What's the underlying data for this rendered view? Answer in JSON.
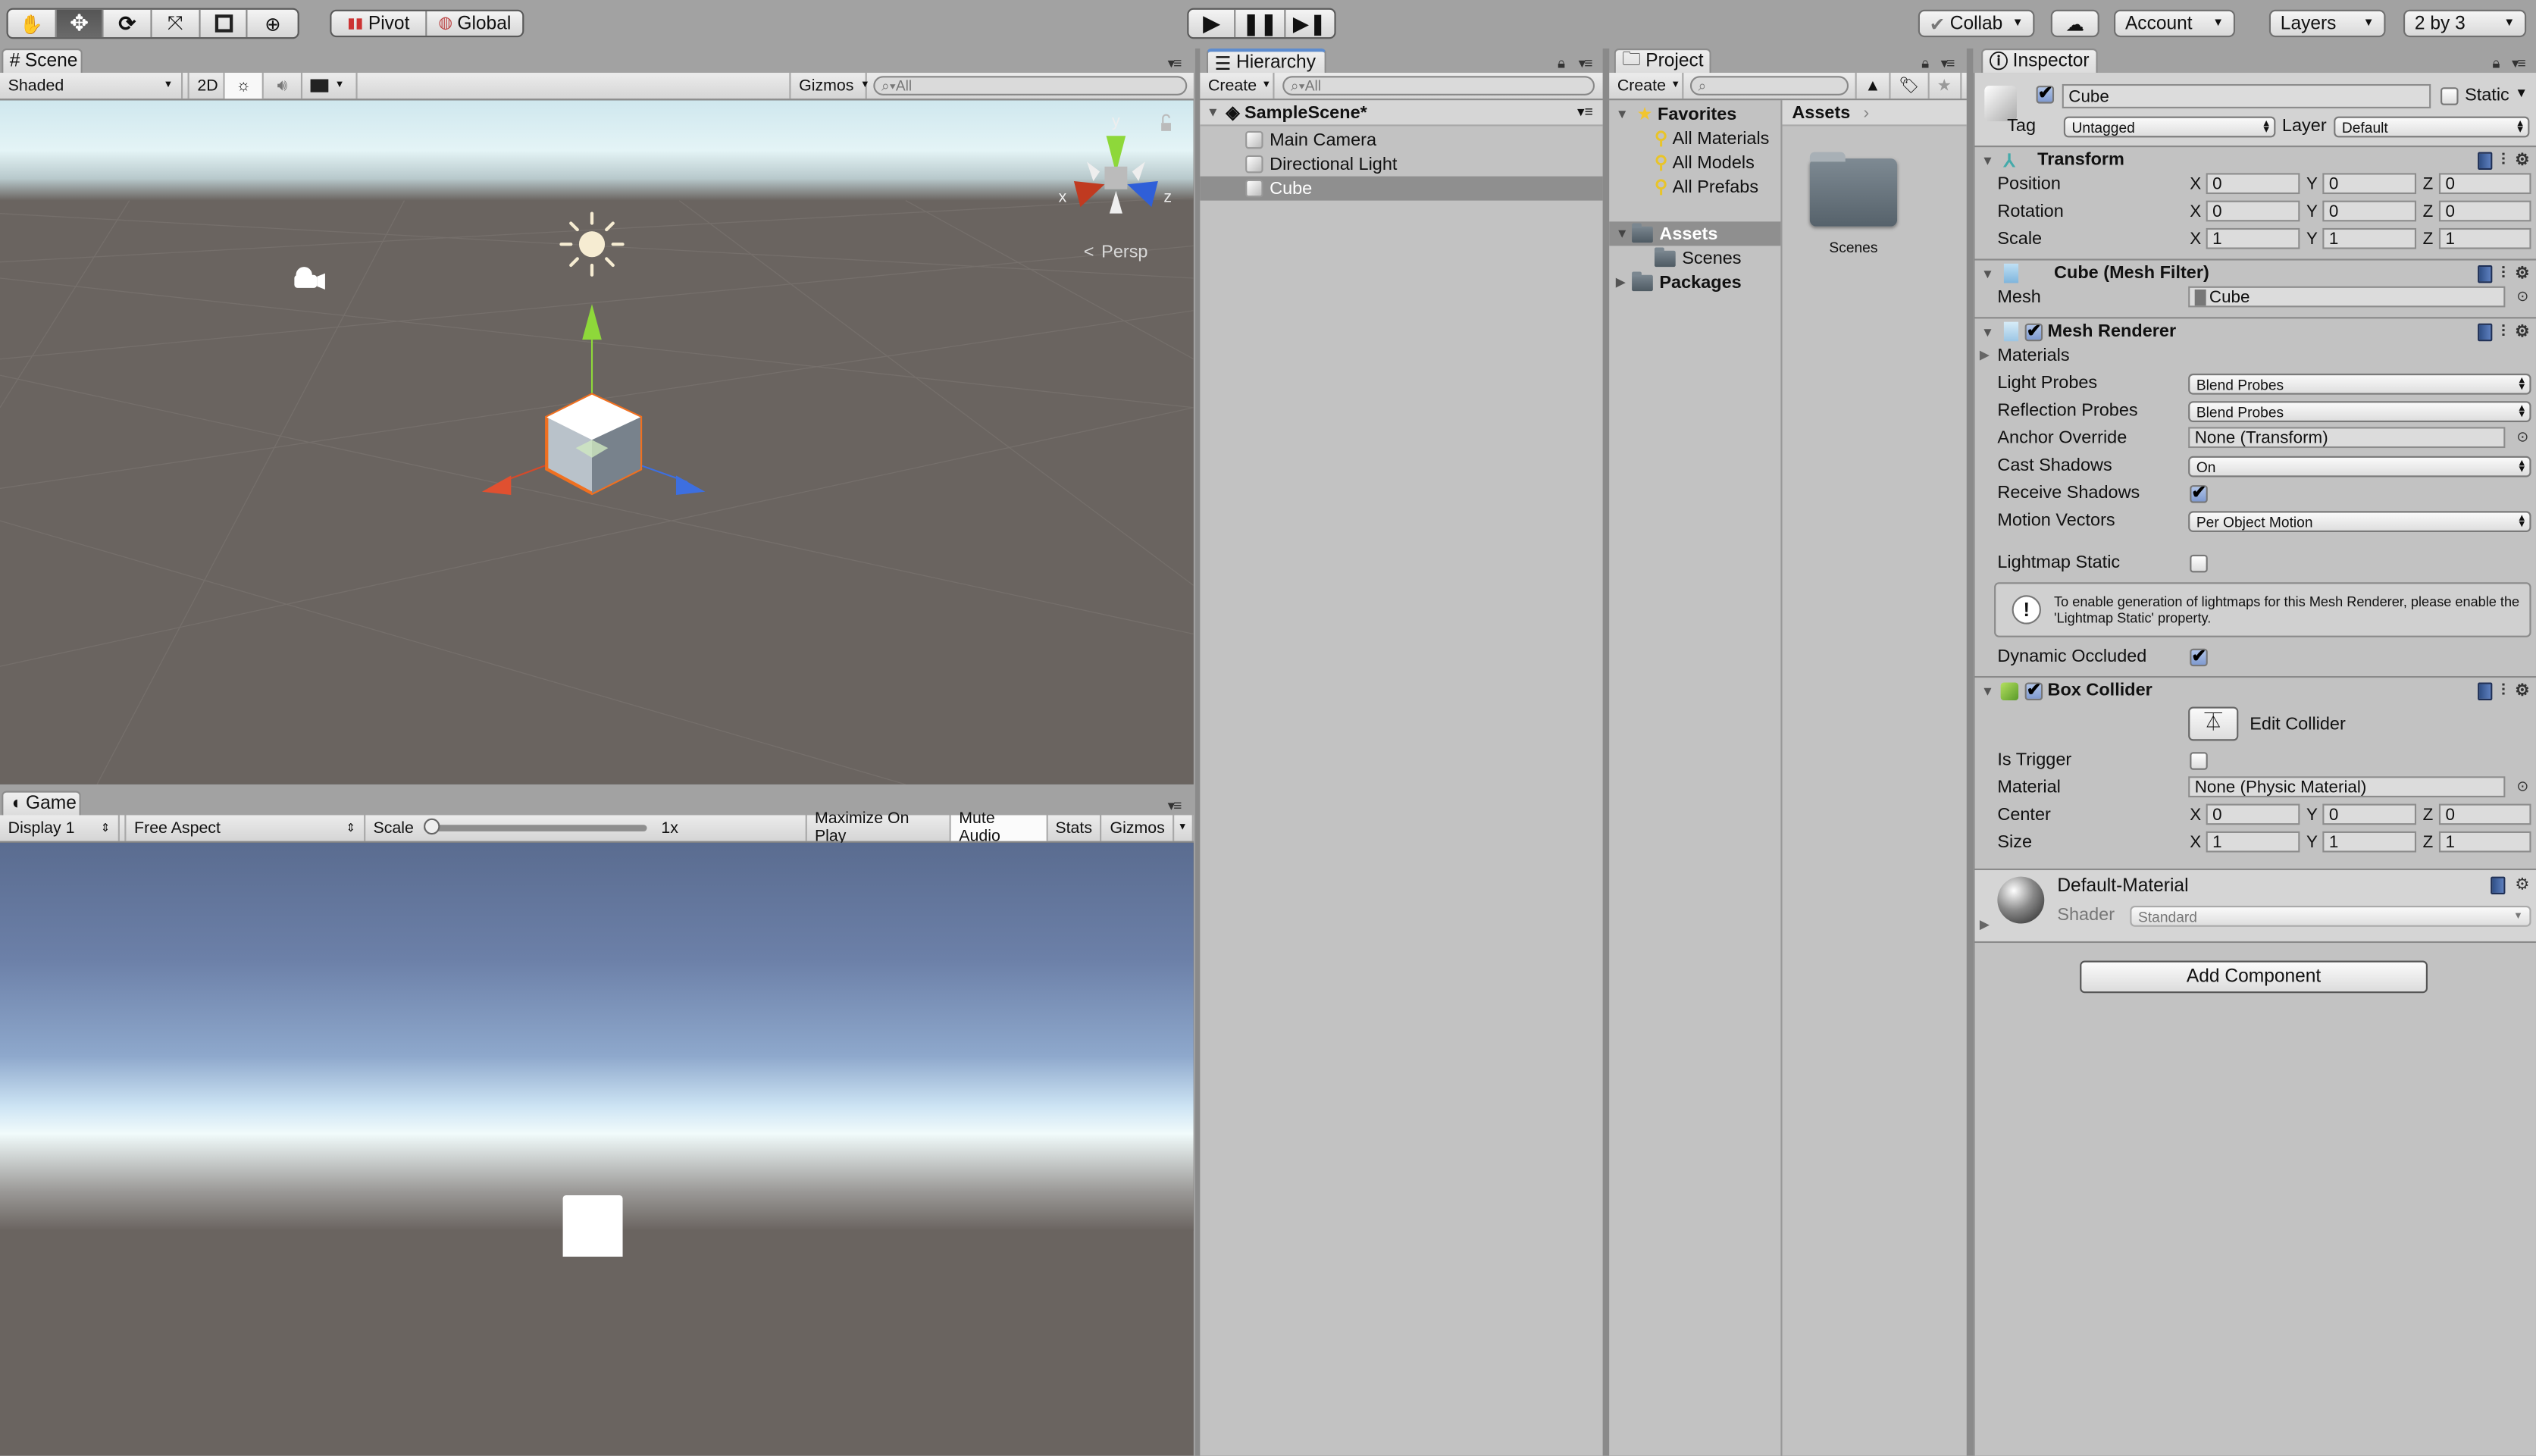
{
  "toolbar": {
    "tools": [
      "hand-tool",
      "move-tool",
      "rotate-tool",
      "scale-tool",
      "rect-tool",
      "transform-tool"
    ],
    "active_tool": "move-tool",
    "pivot_label": "Pivot",
    "global_label": "Global",
    "collab_label": "Collab",
    "account_label": "Account",
    "layers_label": "Layers",
    "layout_label": "2 by 3"
  },
  "scene": {
    "tab_label": "Scene",
    "shading_mode": "Shaded",
    "mode_2d_label": "2D",
    "gizmos_label": "Gizmos",
    "search_placeholder": "All",
    "axis_labels": {
      "x": "x",
      "y": "y",
      "z": "z"
    },
    "projection_label": "Persp"
  },
  "game": {
    "tab_label": "Game",
    "display_label": "Display 1",
    "aspect_label": "Free Aspect",
    "scale_label": "Scale",
    "scale_value": "1x",
    "scale_fraction": 0,
    "maximize_label": "Maximize On Play",
    "mute_label": "Mute Audio",
    "stats_label": "Stats",
    "gizmos_label": "Gizmos"
  },
  "hierarchy": {
    "tab_label": "Hierarchy",
    "create_label": "Create",
    "search_placeholder": "All",
    "scene_name": "SampleScene*",
    "items": [
      {
        "label": "Main Camera",
        "selected": false
      },
      {
        "label": "Directional Light",
        "selected": false
      },
      {
        "label": "Cube",
        "selected": true
      }
    ]
  },
  "project": {
    "tab_label": "Project",
    "create_label": "Create",
    "search_placeholder": "",
    "favorites_label": "Favorites",
    "favorites": [
      "All Materials",
      "All Models",
      "All Prefabs"
    ],
    "assets_label": "Assets",
    "assets_children": [
      "Scenes"
    ],
    "packages_label": "Packages",
    "breadcrumb": "Assets",
    "grid_items": [
      {
        "label": "Scenes",
        "type": "folder"
      }
    ]
  },
  "inspector": {
    "tab_label": "Inspector",
    "object_name": "Cube",
    "object_active": true,
    "static_label": "Static",
    "static_checked": false,
    "tag_label": "Tag",
    "tag_value": "Untagged",
    "layer_label": "Layer",
    "layer_value": "Default",
    "transform": {
      "title": "Transform",
      "rows": [
        {
          "label": "Position",
          "x": "0",
          "y": "0",
          "z": "0"
        },
        {
          "label": "Rotation",
          "x": "0",
          "y": "0",
          "z": "0"
        },
        {
          "label": "Scale",
          "x": "1",
          "y": "1",
          "z": "1"
        }
      ]
    },
    "mesh_filter": {
      "title": "Cube (Mesh Filter)",
      "mesh_label": "Mesh",
      "mesh_value": "Cube"
    },
    "mesh_renderer": {
      "title": "Mesh Renderer",
      "enabled": true,
      "materials_label": "Materials",
      "light_probes_label": "Light Probes",
      "light_probes_value": "Blend Probes",
      "reflection_probes_label": "Reflection Probes",
      "reflection_probes_value": "Blend Probes",
      "anchor_override_label": "Anchor Override",
      "anchor_override_value": "None (Transform)",
      "cast_shadows_label": "Cast Shadows",
      "cast_shadows_value": "On",
      "receive_shadows_label": "Receive Shadows",
      "receive_shadows": true,
      "motion_vectors_label": "Motion Vectors",
      "motion_vectors_value": "Per Object Motion",
      "lightmap_static_label": "Lightmap Static",
      "lightmap_static": false,
      "info_message": "To enable generation of lightmaps for this Mesh Renderer, please enable the 'Lightmap Static' property.",
      "dynamic_occluded_label": "Dynamic Occluded",
      "dynamic_occluded": true
    },
    "box_collider": {
      "title": "Box Collider",
      "enabled": true,
      "edit_collider_label": "Edit Collider",
      "is_trigger_label": "Is Trigger",
      "is_trigger": false,
      "material_label": "Material",
      "material_value": "None (Physic Material)",
      "center": {
        "label": "Center",
        "x": "0",
        "y": "0",
        "z": "0"
      },
      "size": {
        "label": "Size",
        "x": "1",
        "y": "1",
        "z": "1"
      }
    },
    "material": {
      "name": "Default-Material",
      "shader_label": "Shader",
      "shader_value": "Standard"
    },
    "add_component_label": "Add Component"
  },
  "colors": {
    "x_axis": "#d64a2a",
    "y_axis": "#8ed83a",
    "z_axis": "#3d6fe0",
    "selection_outline": "#f07020",
    "tab_focus": "#5d8ccf"
  }
}
